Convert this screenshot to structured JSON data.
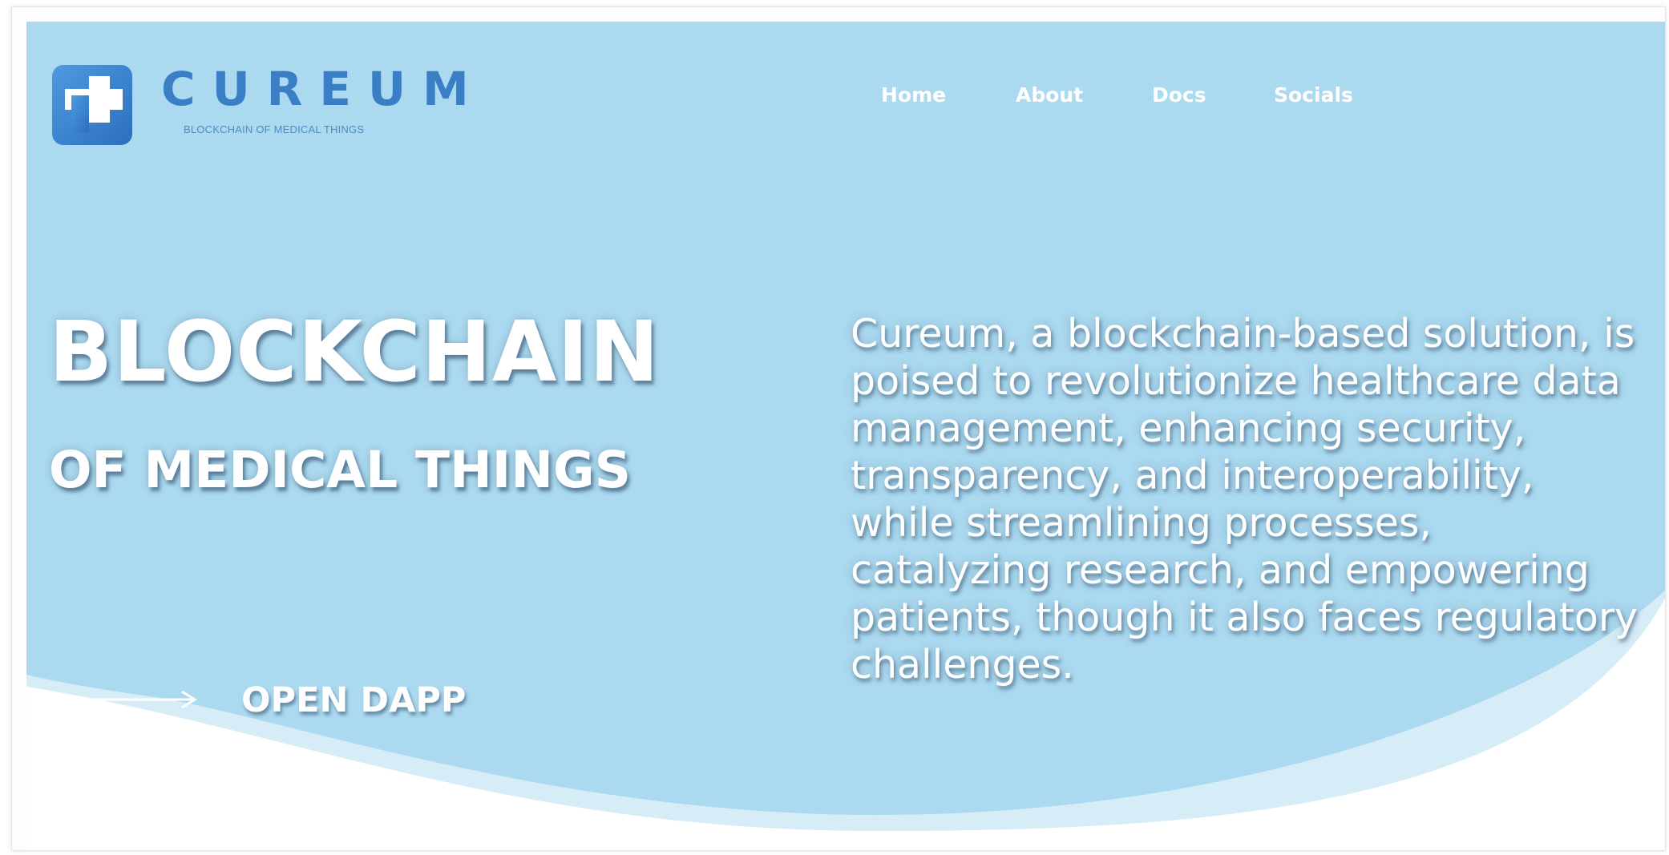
{
  "brand": {
    "name": "CUREUM",
    "tagline": "BLOCKCHAIN OF MEDICAL THINGS",
    "logo_icon": "medical-cross-icon"
  },
  "nav": {
    "items": [
      {
        "label": "Home"
      },
      {
        "label": "About"
      },
      {
        "label": "Docs"
      },
      {
        "label": "Socials"
      }
    ]
  },
  "hero": {
    "headline_line1": "BLOCKCHAIN",
    "headline_line2": "OF MEDICAL THINGS",
    "cta_label": "OPEN DAPP",
    "cta_icon": "arrow-right-icon",
    "description": "Cureum, a blockchain-based solution, is poised to revolutionize healthcare data management, enhancing security, transparency, and interoperability, while streamlining processes, catalyzing research, and empowering patients, though it also faces regulatory challenges."
  },
  "colors": {
    "hero_background": "#abd9ef",
    "wave_light": "#d6ecf7",
    "brand_blue": "#3a7fc6",
    "text": "#ffffff",
    "page": "#ffffff"
  }
}
